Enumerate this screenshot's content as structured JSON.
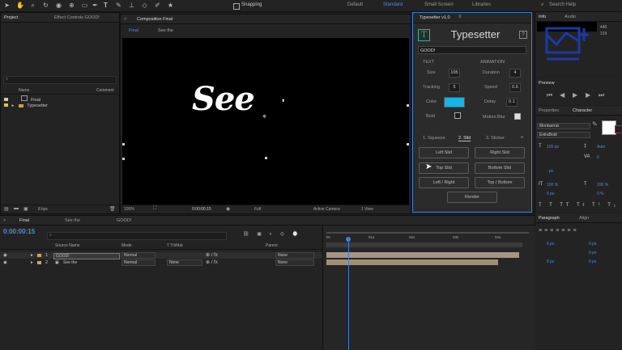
{
  "toolbar": {
    "snapping_label": "Snapping",
    "workspaces": [
      "Default",
      "Standard",
      "Small Screen",
      "Libraries"
    ],
    "active_workspace": "Standard",
    "search_placeholder": "Search Help"
  },
  "project_panel": {
    "tabs": [
      "Project",
      "Effect Controls GOOD!"
    ],
    "columns": [
      "Name",
      "Comment"
    ],
    "items": [
      "Final",
      "Typesetter"
    ],
    "footer": "8 bpc"
  },
  "composition_panel": {
    "tab": "Composition Final",
    "breadcrumbs": [
      "Final",
      "See the"
    ],
    "preview_text": "See",
    "footer": {
      "zoom": "100%",
      "timecode": "0:00:00:15",
      "quality": "Full",
      "camera": "Active Camera",
      "views": "1 View"
    }
  },
  "typesetter": {
    "panel_title": "Typesetter v1.0",
    "logo_letter": "T",
    "app_title": "Typesetter",
    "text_value": "GOOD!",
    "text_section": "TEXT",
    "animation_section": "ANIMATION",
    "text_fields": [
      {
        "label": "Size",
        "value": "105"
      },
      {
        "label": "Tracking",
        "value": "5"
      },
      {
        "label": "Color",
        "value": ""
      },
      {
        "label": "Bold",
        "value": ""
      }
    ],
    "color_value": "#14b4e8",
    "anim_fields": [
      {
        "label": "Duration",
        "value": "4"
      },
      {
        "label": "Speed",
        "value": "0.6"
      },
      {
        "label": "Delay",
        "value": "0.1"
      },
      {
        "label": "Motion Blur",
        "value": ""
      }
    ],
    "tabs": [
      "1. Squeeze",
      "2. Slid",
      "3. Sticker"
    ],
    "buttons": [
      "Left Slid",
      "Right Slid",
      "Top Slid",
      "Bottom Slid",
      "Left / Right",
      "Top / Bottom"
    ],
    "render_label": "Render"
  },
  "info_panel": {
    "tabs": [
      "Info",
      "Audio"
    ],
    "values": [
      "440",
      "319"
    ]
  },
  "preview_panel": {
    "title": "Preview"
  },
  "character_panel": {
    "tabs": [
      "Properties",
      "Character"
    ],
    "font": "Montserrat",
    "style": "ExtraBold",
    "size": "100 px",
    "leading": "Auto",
    "tracking": "5",
    "unit": "- px",
    "scale_v": "100 %",
    "scale_h": "100 %",
    "baseline": "0 px",
    "tsume": "0 %"
  },
  "paragraph_panel": {
    "tabs": [
      "Paragraph",
      "Align"
    ],
    "values": [
      "0 px",
      "0 px",
      "0 px",
      "0 px",
      "0 px"
    ]
  },
  "timeline": {
    "tabs": [
      "Final",
      "See the",
      "GOOD!"
    ],
    "timecode": "0:00:00:15",
    "columns": [
      "Source Name",
      "Mode",
      "T TrkMat",
      "Parent"
    ],
    "layers": [
      {
        "num": "1",
        "name": "GOOD!",
        "mode": "Normal",
        "trkmat": "",
        "parent": "None"
      },
      {
        "num": "2",
        "name": "See the",
        "mode": "Normal",
        "trkmat": "None",
        "parent": "None"
      }
    ],
    "ruler": [
      "0s",
      "01s",
      "02s",
      "03s",
      "04s"
    ]
  }
}
